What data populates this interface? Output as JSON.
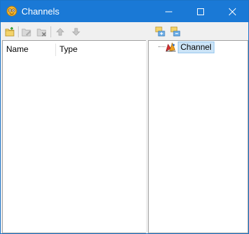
{
  "window": {
    "title": "Channels",
    "title_bar_color": "#1a79d6"
  },
  "toolbar_left": {
    "buttons": [
      {
        "icon": "new-channel-icon",
        "enabled": true
      },
      {
        "icon": "edit-channel-icon",
        "enabled": false
      },
      {
        "icon": "delete-channel-icon",
        "enabled": false
      },
      {
        "icon": "move-up-icon",
        "enabled": false
      },
      {
        "icon": "move-down-icon",
        "enabled": false
      }
    ]
  },
  "toolbar_right": {
    "buttons": [
      {
        "icon": "expand-all-icon",
        "enabled": true
      },
      {
        "icon": "collapse-all-icon",
        "enabled": true
      }
    ]
  },
  "list": {
    "columns": [
      "Name",
      "Type"
    ],
    "rows": []
  },
  "tree": {
    "nodes": [
      {
        "label": "Channel",
        "icon": "channel-icon",
        "selected": true
      }
    ]
  }
}
